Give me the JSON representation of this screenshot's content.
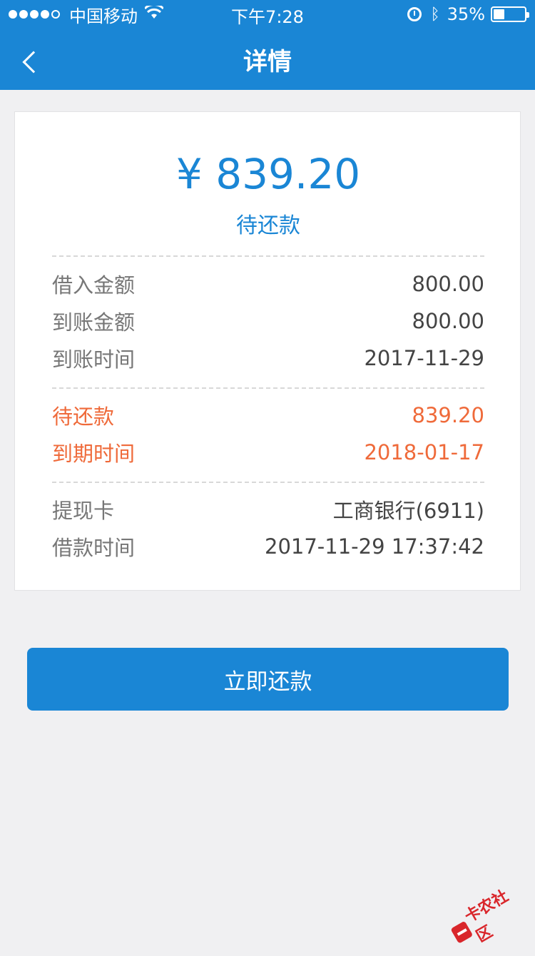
{
  "status_bar": {
    "carrier": "中国移动",
    "time": "下午7:28",
    "battery_pct": "35%",
    "battery_level": 0.35
  },
  "nav": {
    "title": "详情",
    "back_icon": "chevron-left-icon"
  },
  "summary": {
    "amount": "¥ 839.20",
    "status": "待还款"
  },
  "details": [
    {
      "label": "借入金额",
      "value": "800.00"
    },
    {
      "label": "到账金额",
      "value": "800.00"
    },
    {
      "label": "到账时间",
      "value": "2017-11-29"
    }
  ],
  "due": [
    {
      "label": "待还款",
      "value": "839.20"
    },
    {
      "label": "到期时间",
      "value": "2018-01-17"
    }
  ],
  "card_info": [
    {
      "label": "提现卡",
      "value": "工商银行(6911)"
    },
    {
      "label": "借款时间",
      "value": "2017-11-29 17:37:42"
    }
  ],
  "action": {
    "pay_label": "立即还款"
  },
  "watermark": {
    "text": "卡农社区"
  },
  "colors": {
    "primary": "#1a86d5",
    "warning": "#ef6a3a",
    "background": "#f0f0f2"
  }
}
